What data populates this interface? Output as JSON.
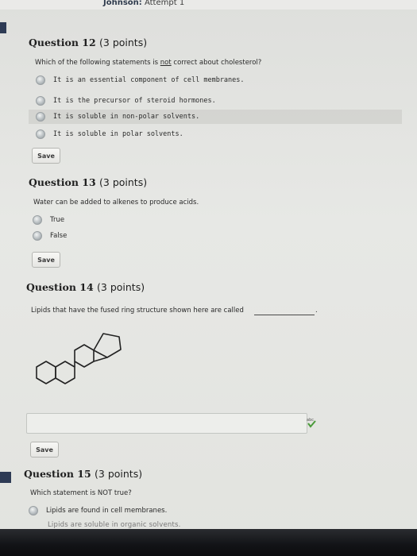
{
  "header": {
    "name_fragment": "Johnson:",
    "attempt": "Attempt 1"
  },
  "q12": {
    "title": "Question 12",
    "points": "(3 points)",
    "prompt_before": "Which of the following statements is ",
    "prompt_underlined": "not",
    "prompt_after": " correct about cholesterol?",
    "options": [
      "It is an essential component of cell membranes.",
      "It is the precursor of steroid hormones.",
      "It is soluble in non-polar solvents.",
      "It is soluble in polar solvents."
    ],
    "save_label": "Save"
  },
  "q13": {
    "title": "Question 13",
    "points": "(3 points)",
    "prompt": "Water can be added to alkenes to produce acids.",
    "options": [
      "True",
      "False"
    ],
    "save_label": "Save"
  },
  "q14": {
    "title": "Question 14",
    "points": "(3 points)",
    "prompt": "Lipids that have the fused ring structure shown here are called",
    "period": ".",
    "answer_value": "",
    "save_label": "Save"
  },
  "q15": {
    "title": "Question 15",
    "points": "(3 points)",
    "prompt": "Which statement is NOT true?",
    "options": [
      "Lipids are found in cell membranes.",
      "Lipids are soluble in organic solvents."
    ]
  },
  "icons": {
    "spell_check": "spell-check-icon"
  }
}
